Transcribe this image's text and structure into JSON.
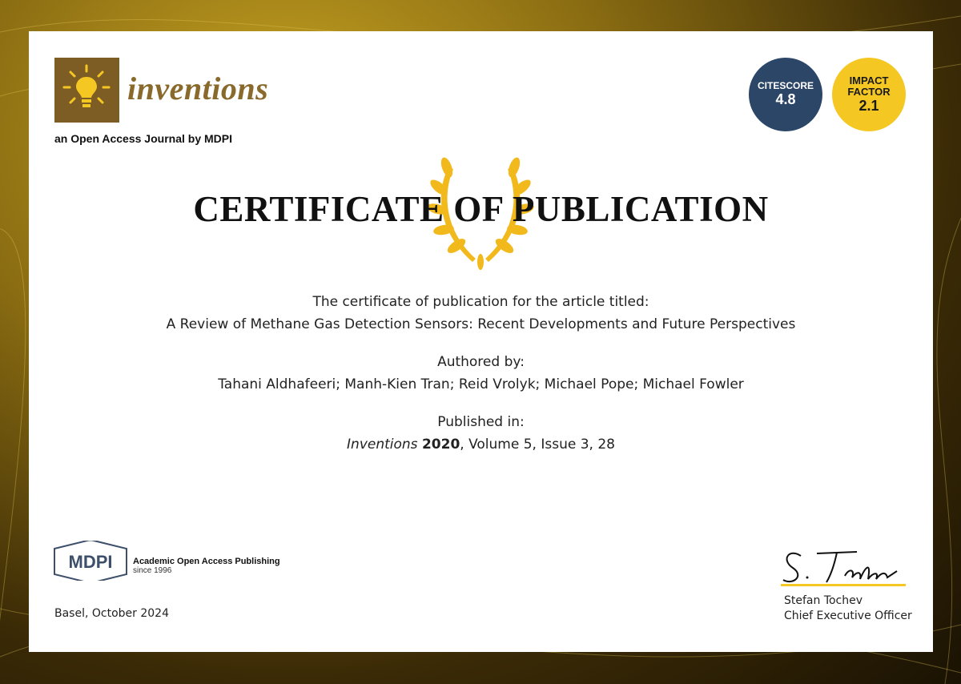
{
  "journal": {
    "name": "inventions",
    "subtitle": "an Open Access Journal by MDPI"
  },
  "badges": {
    "citescore_label": "CITESCORE",
    "citescore_value": "4.8",
    "impact_label_1": "IMPACT",
    "impact_label_2": "FACTOR",
    "impact_value": "2.1"
  },
  "certificate": {
    "title": "CERTIFICATE OF PUBLICATION",
    "intro": "The certificate of publication for the article titled:",
    "article_title": "A Review of Methane Gas Detection Sensors: Recent Developments and Future Perspectives",
    "authored_label": "Authored by:",
    "authors": "Tahani Aldhafeeri; Manh-Kien Tran; Reid Vrolyk; Michael Pope; Michael Fowler",
    "published_label": "Published in:",
    "journal_italic": "Inventions",
    "year": "2020",
    "volume_issue": ", Volume 5, Issue 3, 28"
  },
  "publisher": {
    "logo_text": "MDPI",
    "tagline": "Academic Open Access Publishing",
    "since": "since 1996"
  },
  "footer": {
    "place_date": "Basel, October 2024",
    "signatory_name": "Stefan Tochev",
    "signatory_role": "Chief Executive Officer",
    "signature_text": "S. Tochev"
  },
  "colors": {
    "citescore_bg": "#2c4668",
    "impact_bg": "#f5c722",
    "logo_brown": "#7d5d24",
    "laurel_gold": "#f2b91c"
  }
}
